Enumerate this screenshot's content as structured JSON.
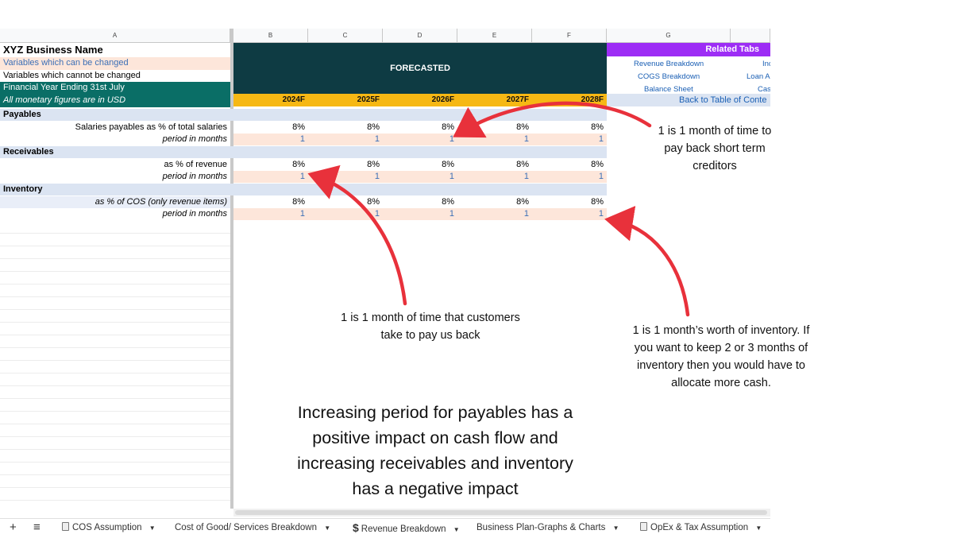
{
  "columns": [
    "A",
    "B",
    "C",
    "D",
    "E",
    "F",
    "G"
  ],
  "header": {
    "business_name": "XYZ Business Name",
    "legend_changeable": "Variables which can be changed",
    "legend_fixed": "Variables which cannot be changed",
    "fy_note": "Financial Year Ending 31st July",
    "currency_note": "All monetary figures are in USD",
    "forecasted": "FORECASTED",
    "years": [
      "2024F",
      "2025F",
      "2026F",
      "2027F",
      "2028F"
    ]
  },
  "related_tabs": {
    "title": "Related Tabs",
    "links": [
      "Revenue Breakdown",
      "COGS Breakdown",
      "Balance Sheet",
      "Inc",
      "Loan A",
      "Cas"
    ],
    "back_link": "Back to Table of Conte"
  },
  "sections": {
    "payables": {
      "title": "Payables",
      "row1_label": "Salaries payables as % of total salaries",
      "row1_values": [
        "8%",
        "8%",
        "8%",
        "8%",
        "8%"
      ],
      "row2_label": "period in months",
      "row2_values": [
        "1",
        "1",
        "1",
        "1",
        "1"
      ]
    },
    "receivables": {
      "title": "Receivables",
      "row1_label": "as % of revenue",
      "row1_values": [
        "8%",
        "8%",
        "8%",
        "8%",
        "8%"
      ],
      "row2_label": "period in months",
      "row2_values": [
        "1",
        "1",
        "1",
        "1",
        "1"
      ]
    },
    "inventory": {
      "title": "Inventory",
      "row1_label": "as % of COS (only revenue items)",
      "row1_values": [
        "8%",
        "8%",
        "8%",
        "8%",
        "8%"
      ],
      "row2_label": "period in months",
      "row2_values": [
        "1",
        "1",
        "1",
        "1",
        "1"
      ]
    }
  },
  "annotations": {
    "payables_note": [
      "1 is 1 month of time to",
      "pay back short term",
      "creditors"
    ],
    "receivables_note": [
      "1 is 1 month of time that customers",
      "take to pay us back"
    ],
    "inventory_note": [
      "1 is 1 month’s worth of inventory. If",
      "you want to keep 2 or 3 months of",
      "inventory then you would have to",
      "allocate more cash."
    ],
    "summary": [
      "Increasing period for payables has a",
      "positive impact on cash flow and",
      "increasing receivables and inventory",
      "has a negative impact"
    ]
  },
  "colors": {
    "changeable_bg": "#fde6da",
    "section_bg": "#dbe4f2",
    "teal": "#0a6e66",
    "dark_teal": "#0e3b43",
    "year_yellow": "#f6b814",
    "purple": "#9d2df5",
    "arrow_red": "#e8313b"
  },
  "bottom_tabs": {
    "add": "+",
    "menu": "≡",
    "tabs": [
      "COS Assumption",
      "Cost of Good/ Services Breakdown",
      "Revenue Breakdown",
      "Business Plan-Graphs & Charts",
      "OpEx & Tax Assumption"
    ]
  }
}
